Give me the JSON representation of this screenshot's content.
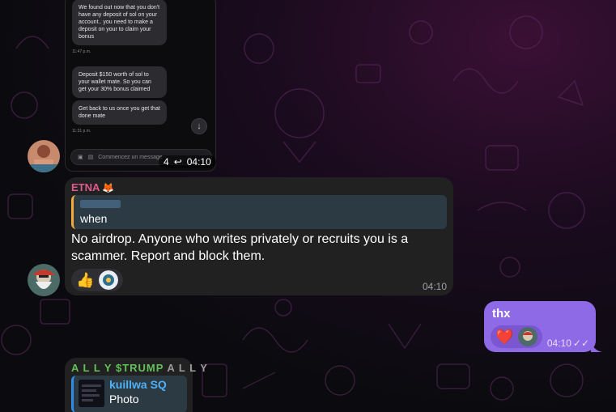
{
  "screenshot": {
    "messages": [
      "We found out now that you don't have any deposit of sol on your account.. you need to make a deposit on your to claim your bonus",
      "Deposit $150 worth of sol to your wallet mate. So you can get your 30% bonus claimed",
      "Get back to us once you get that done mate"
    ],
    "times": [
      "11:47 p.m.",
      "11:31 p.m."
    ],
    "input_placeholder": "Commencez un message",
    "forward_count": "4",
    "time": "04:10"
  },
  "etna_message": {
    "sender": "ETNA",
    "sender_color": "#e05b8c",
    "reply_text": "when",
    "text": "No airdrop. Anyone who writes privately or recruits you is a scammer. Report and block them.",
    "reaction_emoji": "👍",
    "time": "04:10"
  },
  "outgoing_message": {
    "text": "thx",
    "reaction_emoji": "❤️",
    "time": "04:10",
    "bubble_color": "#8f6ae6"
  },
  "bottom_message": {
    "sender": "A L L Y $TRUMP",
    "sender_suffix": "A L L Y",
    "reply_name": "kuillwa SQ",
    "reply_text": "Photo"
  }
}
